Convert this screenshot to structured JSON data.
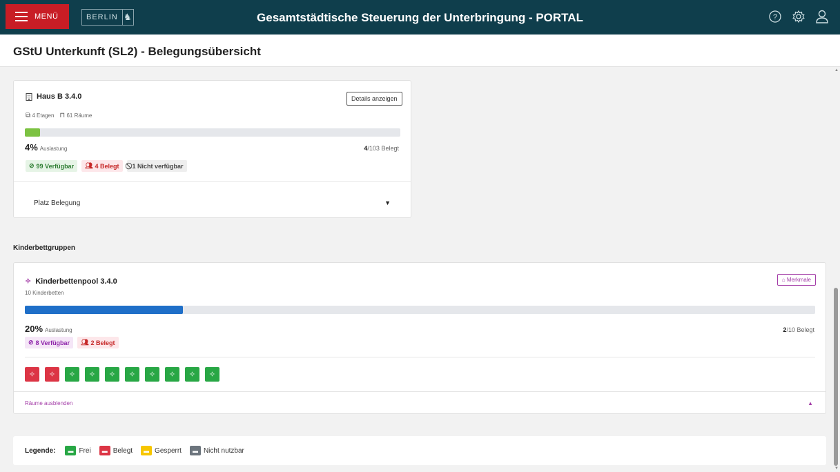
{
  "topbar": {
    "menu_label": "MENÜ",
    "logo_text": "BERLIN",
    "title": "Gesamtstädtische Steuerung der Unterbringung - PORTAL"
  },
  "page": {
    "title": "GStU Unterkunft (SL2) - Belegungsübersicht"
  },
  "house": {
    "title": "Haus B 3.4.0",
    "details_button": "Details anzeigen",
    "floors": "4 Etagen",
    "rooms": "61 Räume",
    "percent": "4%",
    "percent_fraction": 0.04,
    "auslastung_label": "Auslastung",
    "occupied": "4",
    "capacity": "/103",
    "belegt_label": "Belegt",
    "badge_available": "99 Verfügbar",
    "badge_occupied": "4 Belegt",
    "badge_unavailable": "1 Nicht verfügbar",
    "accordion_label": "Platz Belegung"
  },
  "kinder_section": {
    "title": "Kinderbettgruppen"
  },
  "kinder": {
    "title": "Kinderbettenpool 3.4.0",
    "merkmale_button": "Merkmale",
    "subtitle": "10 Kinderbetten",
    "percent": "20%",
    "percent_fraction": 0.2,
    "auslastung_label": "Auslastung",
    "occupied": "2",
    "capacity": "/10",
    "belegt_label": "Belegt",
    "badge_available": "8 Verfügbar",
    "badge_occupied": "2 Belegt",
    "beds": [
      "belegt",
      "belegt",
      "frei",
      "frei",
      "frei",
      "frei",
      "frei",
      "frei",
      "frei",
      "frei"
    ],
    "hide_rooms_link": "Räume ausblenden"
  },
  "legend": {
    "label": "Legende:",
    "items": [
      {
        "label": "Frei",
        "color": "#28a745"
      },
      {
        "label": "Belegt",
        "color": "#dc3545"
      },
      {
        "label": "Gesperrt",
        "color": "#f7c600"
      },
      {
        "label": "Nicht nutzbar",
        "color": "#6c757d"
      }
    ]
  },
  "colors": {
    "topbar": "#0f3e4c",
    "menu": "#c81d25",
    "house_progress": "#7cc242",
    "kinder_progress": "#1f6fc8",
    "accent_purple": "#a43ea8"
  }
}
